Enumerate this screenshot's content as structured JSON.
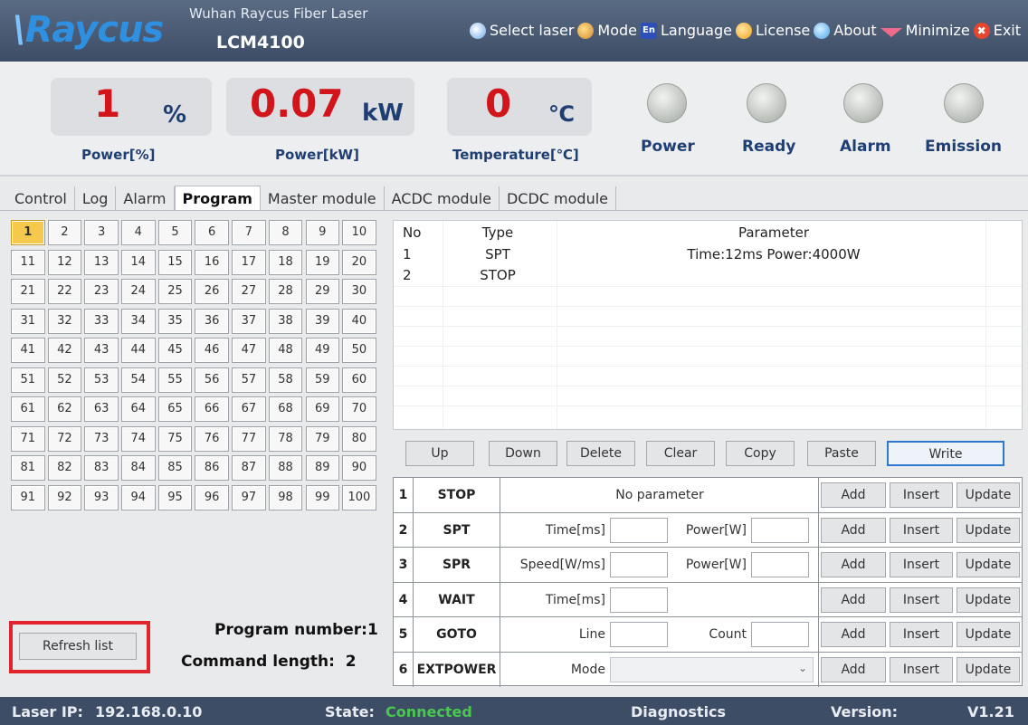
{
  "header": {
    "logo": "Raycus",
    "company": "Wuhan Raycus Fiber Laser",
    "model": "LCM4100",
    "menu": [
      {
        "label": "Select laser",
        "icon": "select-laser-icon"
      },
      {
        "label": "Mode",
        "icon": "mode-icon"
      },
      {
        "label": "Language",
        "icon": "language-icon"
      },
      {
        "label": "License",
        "icon": "license-icon"
      },
      {
        "label": "About",
        "icon": "about-icon"
      },
      {
        "label": "Minimize",
        "icon": "minimize-icon"
      },
      {
        "label": "Exit",
        "icon": "exit-icon"
      }
    ],
    "lang_glyph": "En",
    "exit_glyph": "✖"
  },
  "status": {
    "power_pct": {
      "value": "1",
      "unit": "%",
      "label": "Power[%]"
    },
    "power_kw": {
      "value": "0.07",
      "unit": "kW",
      "label": "Power[kW]"
    },
    "temperature": {
      "value": "0",
      "unit": "℃",
      "label": "Temperature[℃]"
    },
    "lamps": [
      {
        "label": "Power",
        "state": "off"
      },
      {
        "label": "Ready",
        "state": "off"
      },
      {
        "label": "Alarm",
        "state": "off"
      },
      {
        "label": "Emission",
        "state": "off"
      }
    ]
  },
  "tabs": [
    "Control",
    "Log",
    "Alarm",
    "Program",
    "Master module",
    "ACDC module",
    "DCDC module"
  ],
  "active_tab": "Program",
  "program": {
    "selected": 1,
    "number_label": "Program number:1",
    "length_label": "Command length:  2",
    "refresh_label": "Refresh list"
  },
  "list": {
    "headers": {
      "no": "No",
      "type": "Type",
      "param": "Parameter"
    },
    "rows": [
      {
        "no": "1",
        "type": "SPT",
        "param": "Time:12ms Power:4000W"
      },
      {
        "no": "2",
        "type": "STOP",
        "param": ""
      }
    ]
  },
  "actions": [
    "Up",
    "Down",
    "Delete",
    "Clear",
    "Copy",
    "Paste",
    "Write"
  ],
  "commands": [
    {
      "idx": "1",
      "name": "STOP",
      "nofield": "No parameter"
    },
    {
      "idx": "2",
      "name": "SPT",
      "f1": "Time[ms]",
      "f2": "Power[W]"
    },
    {
      "idx": "3",
      "name": "SPR",
      "f1": "Speed[W/ms]",
      "f2": "Power[W]"
    },
    {
      "idx": "4",
      "name": "WAIT",
      "f1": "Time[ms]"
    },
    {
      "idx": "5",
      "name": "GOTO",
      "f1": "Line",
      "f2": "Count"
    },
    {
      "idx": "6",
      "name": "EXTPOWER",
      "f1": "Mode",
      "select": ""
    }
  ],
  "command_buttons": {
    "add": "Add",
    "insert": "Insert",
    "update": "Update"
  },
  "footer": {
    "ip_label": "Laser IP:",
    "ip": "192.168.0.10",
    "state_label": "State:",
    "state": "Connected",
    "diagnostics": "Diagnostics",
    "version_label": "Version:",
    "version": "V1.21"
  },
  "colors": {
    "accent": "#2f8fe0",
    "readout": "#d1151b",
    "label": "#1f3f73",
    "connected": "#48c84e",
    "highlight": "#e0242b"
  }
}
